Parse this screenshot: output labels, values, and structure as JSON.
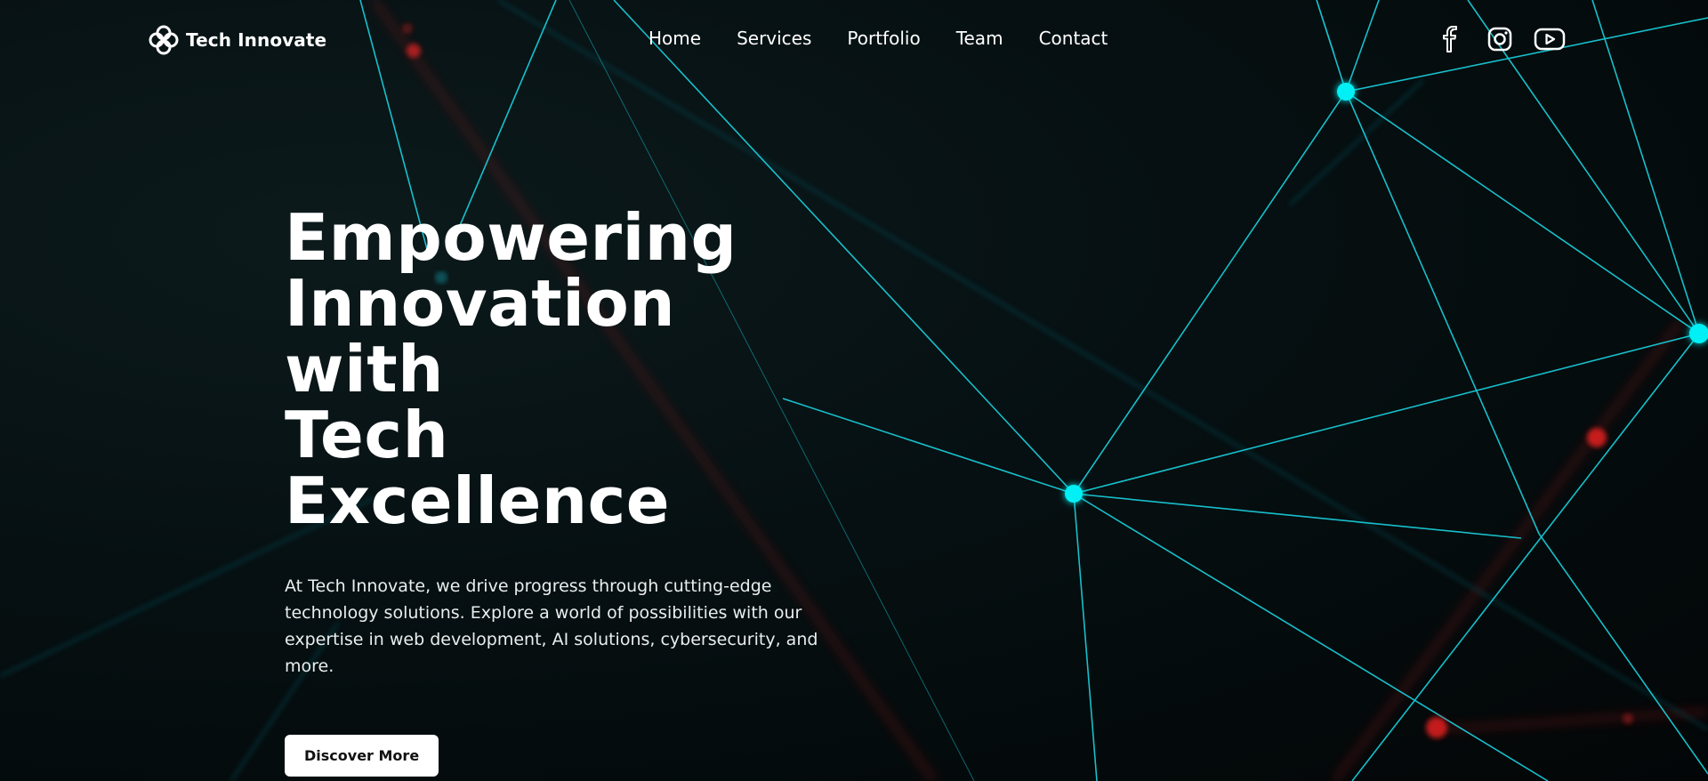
{
  "brand": {
    "name": "Tech Innovate",
    "logo_icon": "quatrefoil-logo-icon"
  },
  "nav": {
    "items": [
      {
        "label": "Home"
      },
      {
        "label": "Services"
      },
      {
        "label": "Portfolio"
      },
      {
        "label": "Team"
      },
      {
        "label": "Contact"
      }
    ]
  },
  "socials": [
    {
      "icon": "facebook-icon"
    },
    {
      "icon": "instagram-icon"
    },
    {
      "icon": "youtube-icon"
    }
  ],
  "hero": {
    "title": "Empowering\nInnovation with\nTech Excellence",
    "description": "At Tech Innovate, we drive progress through cutting-edge technology solutions. Explore a world of possibilities with our expertise in web development, AI solutions, cybersecurity, and more.",
    "button_label": "Discover More"
  },
  "colors": {
    "background": "#050a0c",
    "accent_cyan": "#00e5ee",
    "accent_red": "#e02020",
    "button_background": "#ffffff",
    "button_text": "#111111"
  }
}
